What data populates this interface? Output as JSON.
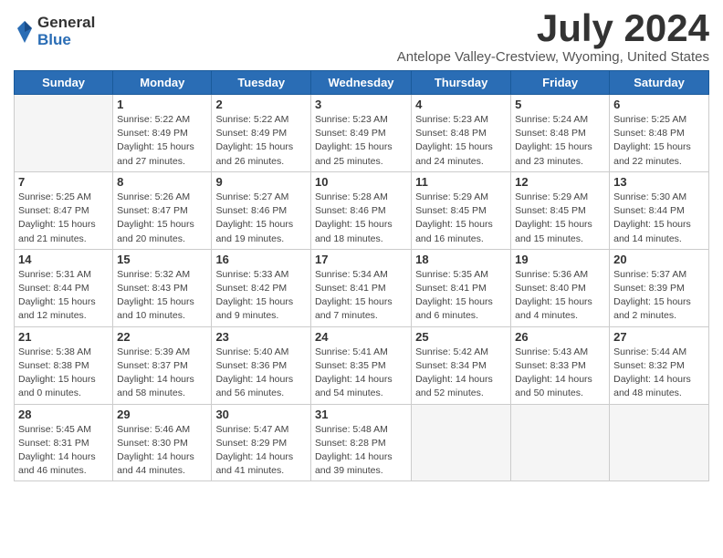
{
  "logo": {
    "general": "General",
    "blue": "Blue"
  },
  "title": "July 2024",
  "location": "Antelope Valley-Crestview, Wyoming, United States",
  "days_of_week": [
    "Sunday",
    "Monday",
    "Tuesday",
    "Wednesday",
    "Thursday",
    "Friday",
    "Saturday"
  ],
  "weeks": [
    [
      {
        "day": "",
        "info": ""
      },
      {
        "day": "1",
        "info": "Sunrise: 5:22 AM\nSunset: 8:49 PM\nDaylight: 15 hours\nand 27 minutes."
      },
      {
        "day": "2",
        "info": "Sunrise: 5:22 AM\nSunset: 8:49 PM\nDaylight: 15 hours\nand 26 minutes."
      },
      {
        "day": "3",
        "info": "Sunrise: 5:23 AM\nSunset: 8:49 PM\nDaylight: 15 hours\nand 25 minutes."
      },
      {
        "day": "4",
        "info": "Sunrise: 5:23 AM\nSunset: 8:48 PM\nDaylight: 15 hours\nand 24 minutes."
      },
      {
        "day": "5",
        "info": "Sunrise: 5:24 AM\nSunset: 8:48 PM\nDaylight: 15 hours\nand 23 minutes."
      },
      {
        "day": "6",
        "info": "Sunrise: 5:25 AM\nSunset: 8:48 PM\nDaylight: 15 hours\nand 22 minutes."
      }
    ],
    [
      {
        "day": "7",
        "info": "Sunrise: 5:25 AM\nSunset: 8:47 PM\nDaylight: 15 hours\nand 21 minutes."
      },
      {
        "day": "8",
        "info": "Sunrise: 5:26 AM\nSunset: 8:47 PM\nDaylight: 15 hours\nand 20 minutes."
      },
      {
        "day": "9",
        "info": "Sunrise: 5:27 AM\nSunset: 8:46 PM\nDaylight: 15 hours\nand 19 minutes."
      },
      {
        "day": "10",
        "info": "Sunrise: 5:28 AM\nSunset: 8:46 PM\nDaylight: 15 hours\nand 18 minutes."
      },
      {
        "day": "11",
        "info": "Sunrise: 5:29 AM\nSunset: 8:45 PM\nDaylight: 15 hours\nand 16 minutes."
      },
      {
        "day": "12",
        "info": "Sunrise: 5:29 AM\nSunset: 8:45 PM\nDaylight: 15 hours\nand 15 minutes."
      },
      {
        "day": "13",
        "info": "Sunrise: 5:30 AM\nSunset: 8:44 PM\nDaylight: 15 hours\nand 14 minutes."
      }
    ],
    [
      {
        "day": "14",
        "info": "Sunrise: 5:31 AM\nSunset: 8:44 PM\nDaylight: 15 hours\nand 12 minutes."
      },
      {
        "day": "15",
        "info": "Sunrise: 5:32 AM\nSunset: 8:43 PM\nDaylight: 15 hours\nand 10 minutes."
      },
      {
        "day": "16",
        "info": "Sunrise: 5:33 AM\nSunset: 8:42 PM\nDaylight: 15 hours\nand 9 minutes."
      },
      {
        "day": "17",
        "info": "Sunrise: 5:34 AM\nSunset: 8:41 PM\nDaylight: 15 hours\nand 7 minutes."
      },
      {
        "day": "18",
        "info": "Sunrise: 5:35 AM\nSunset: 8:41 PM\nDaylight: 15 hours\nand 6 minutes."
      },
      {
        "day": "19",
        "info": "Sunrise: 5:36 AM\nSunset: 8:40 PM\nDaylight: 15 hours\nand 4 minutes."
      },
      {
        "day": "20",
        "info": "Sunrise: 5:37 AM\nSunset: 8:39 PM\nDaylight: 15 hours\nand 2 minutes."
      }
    ],
    [
      {
        "day": "21",
        "info": "Sunrise: 5:38 AM\nSunset: 8:38 PM\nDaylight: 15 hours\nand 0 minutes."
      },
      {
        "day": "22",
        "info": "Sunrise: 5:39 AM\nSunset: 8:37 PM\nDaylight: 14 hours\nand 58 minutes."
      },
      {
        "day": "23",
        "info": "Sunrise: 5:40 AM\nSunset: 8:36 PM\nDaylight: 14 hours\nand 56 minutes."
      },
      {
        "day": "24",
        "info": "Sunrise: 5:41 AM\nSunset: 8:35 PM\nDaylight: 14 hours\nand 54 minutes."
      },
      {
        "day": "25",
        "info": "Sunrise: 5:42 AM\nSunset: 8:34 PM\nDaylight: 14 hours\nand 52 minutes."
      },
      {
        "day": "26",
        "info": "Sunrise: 5:43 AM\nSunset: 8:33 PM\nDaylight: 14 hours\nand 50 minutes."
      },
      {
        "day": "27",
        "info": "Sunrise: 5:44 AM\nSunset: 8:32 PM\nDaylight: 14 hours\nand 48 minutes."
      }
    ],
    [
      {
        "day": "28",
        "info": "Sunrise: 5:45 AM\nSunset: 8:31 PM\nDaylight: 14 hours\nand 46 minutes."
      },
      {
        "day": "29",
        "info": "Sunrise: 5:46 AM\nSunset: 8:30 PM\nDaylight: 14 hours\nand 44 minutes."
      },
      {
        "day": "30",
        "info": "Sunrise: 5:47 AM\nSunset: 8:29 PM\nDaylight: 14 hours\nand 41 minutes."
      },
      {
        "day": "31",
        "info": "Sunrise: 5:48 AM\nSunset: 8:28 PM\nDaylight: 14 hours\nand 39 minutes."
      },
      {
        "day": "",
        "info": ""
      },
      {
        "day": "",
        "info": ""
      },
      {
        "day": "",
        "info": ""
      }
    ]
  ]
}
